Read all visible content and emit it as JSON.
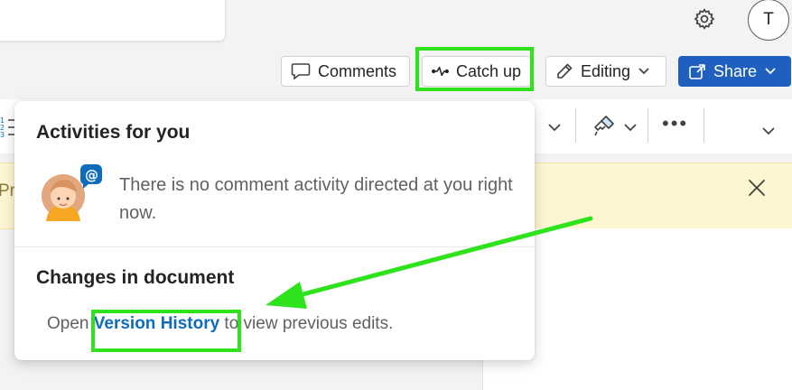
{
  "header": {
    "avatar_initial": "T"
  },
  "toolbar": {
    "comments_label": "Comments",
    "catchup_label": "Catch up",
    "editing_label": "Editing",
    "share_label": "Share"
  },
  "banner": {
    "text_fragment": "Pri"
  },
  "popup": {
    "activities_title": "Activities for you",
    "empty_message": "There is no comment activity directed at you right now.",
    "changes_title": "Changes in document",
    "changes_prefix": "Open ",
    "version_history_link": "Version History",
    "changes_suffix": " to view previous edits."
  },
  "icons": {
    "settings": "gear-icon",
    "comments": "comment-bubble-icon",
    "catchup": "pulse-icon",
    "editing": "pencil-icon",
    "share": "share-icon",
    "close": "close-icon",
    "mention": "at-mention-icon"
  },
  "colors": {
    "share_button": "#1f5fbf",
    "link": "#0f6cbd",
    "highlight": "#2ee21c",
    "banner": "#fdf6d3"
  }
}
